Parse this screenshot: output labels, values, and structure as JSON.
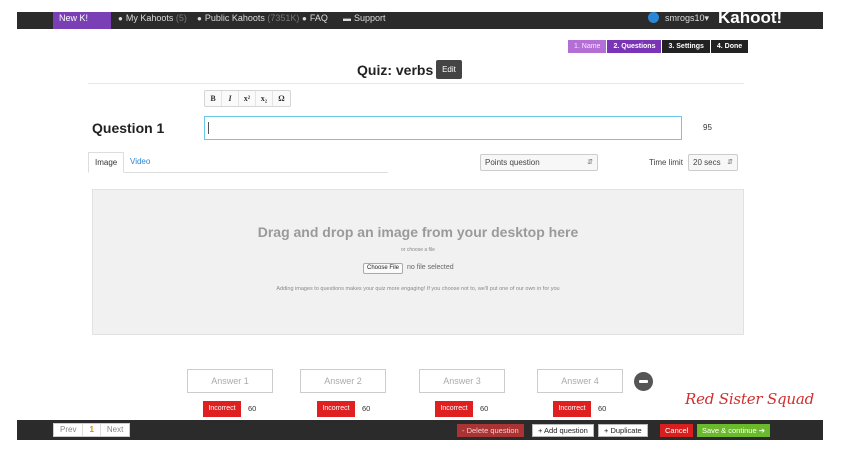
{
  "topbar": {
    "new_label": "New K!",
    "nav": [
      {
        "label": "My Kahoots",
        "count": "(5)",
        "icon": "user-icon"
      },
      {
        "label": "Public Kahoots",
        "count": "(7351K)",
        "icon": "globe-icon"
      },
      {
        "label": "FAQ",
        "count": "",
        "icon": "question-icon"
      },
      {
        "label": "Support",
        "count": "",
        "icon": "chat-icon"
      }
    ],
    "username": "smrogs10",
    "brand": "Kahoot!"
  },
  "steps": [
    {
      "label": "1. Name",
      "state": "done"
    },
    {
      "label": "2. Questions",
      "state": "active"
    },
    {
      "label": "3. Settings",
      "state": "todo"
    },
    {
      "label": "4. Done",
      "state": "todo"
    }
  ],
  "quiz": {
    "title": "Quiz: verbs",
    "edit_label": "Edit"
  },
  "format_buttons": [
    "B",
    "I",
    "x²",
    "x₂",
    "Ω"
  ],
  "question": {
    "label": "Question 1",
    "text": "",
    "chars_left": "95"
  },
  "media_tabs": {
    "image": "Image",
    "video": "Video"
  },
  "question_type": "Points question",
  "time_limit": {
    "label": "Time limit",
    "value": "20 secs"
  },
  "dropzone": {
    "headline": "Drag and drop an image from your desktop here",
    "or_text": "or choose a file",
    "choose_label": "Choose File",
    "file_status": "no file selected",
    "hint": "Adding images to questions makes your quiz more engaging! If you choose not to, we'll put one of our own in for you"
  },
  "answers": [
    {
      "placeholder": "Answer 1",
      "status": "Incorrect",
      "time": "60"
    },
    {
      "placeholder": "Answer 2",
      "status": "Incorrect",
      "time": "60"
    },
    {
      "placeholder": "Answer 3",
      "status": "Incorrect",
      "time": "60"
    },
    {
      "placeholder": "Answer 4",
      "status": "Incorrect",
      "time": "60"
    }
  ],
  "watermark": "Red Sister Squad",
  "footer": {
    "prev": "Prev",
    "page": "1",
    "next": "Next",
    "delete": "- Delete question",
    "add": "+ Add question",
    "duplicate": "+ Duplicate",
    "cancel": "Cancel",
    "save": "Save & continue ➔"
  },
  "colors": {
    "topbar": "#2b2b2b",
    "accent_purple": "#7a35b6",
    "incorrect_red": "#e02020",
    "save_green": "#6aba2c",
    "input_focus": "#6cc8e8"
  }
}
